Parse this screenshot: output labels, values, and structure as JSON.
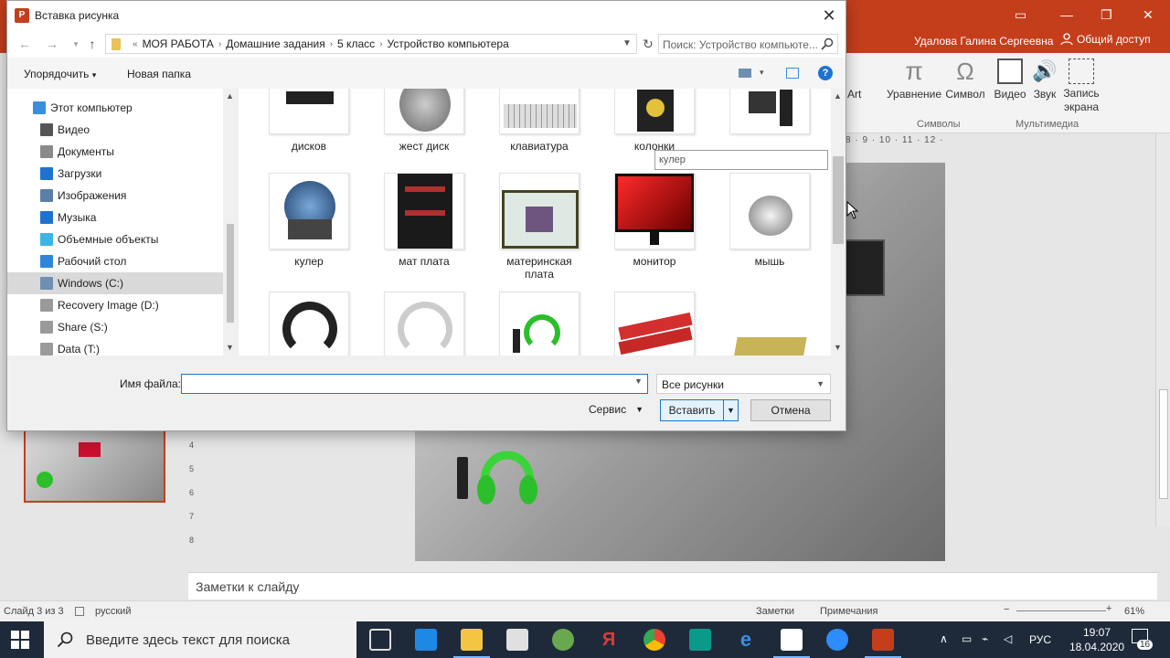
{
  "colors": {
    "accent": "#c43e1c",
    "focus": "#1979ca",
    "selection": "#d9d9d9",
    "taskbar": "#1e2a3a"
  },
  "powerpoint": {
    "user_name": "Удалова Галина Сергеевна",
    "share_label": "Общий доступ",
    "ribbon": {
      "art_label": "Art",
      "equation_label": "Уравнение",
      "symbol_label": "Символ",
      "video_label": "Видео",
      "sound_label": "Звук",
      "record_label_1": "Запись",
      "record_label_2": "экрана",
      "group_symbols": "Символы",
      "group_media": "Мультимедиа"
    },
    "ruler_text": "8 · 9 · 10 · 11 · 12 ·",
    "notes_placeholder": "Заметки к слайду",
    "status": {
      "slide_info": "Слайд 3 из 3",
      "language": "русский",
      "notes_btn": "Заметки",
      "comments_btn": "Примечания",
      "zoom": "61%"
    }
  },
  "taskbar": {
    "search_placeholder": "Введите здесь текст для поиска",
    "language": "РУС",
    "time": "19:07",
    "date": "18.04.2020",
    "notification_count": "16"
  },
  "dialog": {
    "title": "Вставка рисунка",
    "breadcrumbs": [
      "МОЯ РАБОТА",
      "Домашние задания",
      "5 класс",
      "Устройство компьютера"
    ],
    "search_placeholder": "Поиск: Устройство компьюте...",
    "organize_label": "Упорядочить",
    "new_folder_label": "Новая папка",
    "tree": [
      {
        "label": "Этот компьютер",
        "icon": "computer-icon",
        "color": "#3b8ede"
      },
      {
        "label": "Видео",
        "icon": "video-folder-icon",
        "color": "#555555"
      },
      {
        "label": "Документы",
        "icon": "documents-icon",
        "color": "#8a8a8a"
      },
      {
        "label": "Загрузки",
        "icon": "downloads-icon",
        "color": "#1e73d2"
      },
      {
        "label": "Изображения",
        "icon": "pictures-icon",
        "color": "#5a7fa8"
      },
      {
        "label": "Музыка",
        "icon": "music-icon",
        "color": "#1e73d2"
      },
      {
        "label": "Объемные объекты",
        "icon": "3d-objects-icon",
        "color": "#3db4e8"
      },
      {
        "label": "Рабочий стол",
        "icon": "desktop-icon",
        "color": "#2f86d8"
      },
      {
        "label": "Windows (C:)",
        "icon": "drive-c-icon",
        "color": "#6d8fb2"
      },
      {
        "label": "Recovery Image (D:)",
        "icon": "drive-d-icon",
        "color": "#9a9a9a"
      },
      {
        "label": "Share (S:)",
        "icon": "network-drive-icon",
        "color": "#9a9a9a"
      },
      {
        "label": "Data (T:)",
        "icon": "network-drive-icon",
        "color": "#9a9a9a"
      }
    ],
    "files": [
      {
        "label": "дисков",
        "label2": ""
      },
      {
        "label": "жест диск",
        "label2": ""
      },
      {
        "label": "клавиатура",
        "label2": ""
      },
      {
        "label": "колонки",
        "label2": ""
      },
      {
        "label": "",
        "label2": ""
      },
      {
        "label": "кулер",
        "label2": ""
      },
      {
        "label": "мат плата",
        "label2": ""
      },
      {
        "label": "материнская",
        "label2": "плата"
      },
      {
        "label": "монитор",
        "label2": ""
      },
      {
        "label": "мышь",
        "label2": ""
      }
    ],
    "tooltip": "кулер",
    "filename_label": "Имя файла:",
    "filename_value": "",
    "filetype": "Все рисунки",
    "service_label": "Сервис",
    "insert_label": "Вставить",
    "cancel_label": "Отмена"
  }
}
